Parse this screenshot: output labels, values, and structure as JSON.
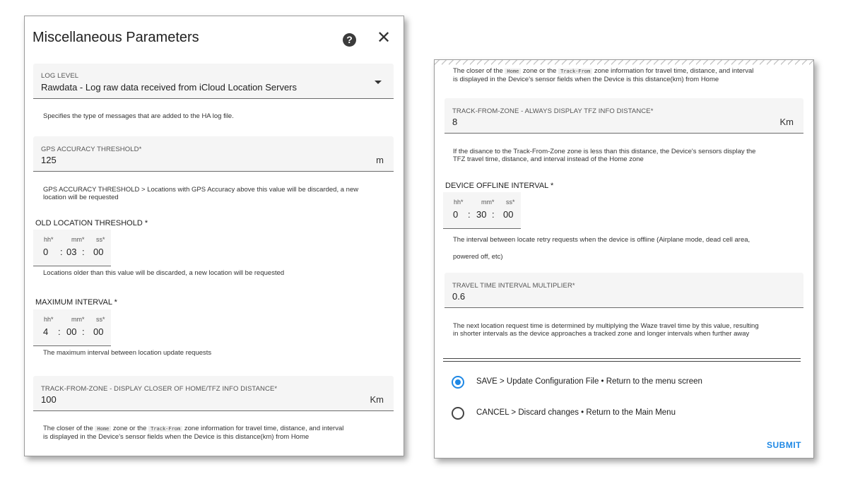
{
  "dialog": {
    "title": "Miscellaneous Parameters",
    "help_icon": "question-circle-icon",
    "close_icon": "close-x-icon"
  },
  "left": {
    "log_level": {
      "label": "Log Level",
      "value": "Rawdata - Log raw data received from iCloud Location Servers",
      "help": "Specifies the type of messages that are added to the HA log file."
    },
    "gps_accuracy": {
      "label": "GPS Accuracy Threshold*",
      "value": "125",
      "suffix": "m",
      "help": "GPS ACCURACY THRESHOLD > Locations with GPS Accuracy above this value will be discarded, a new location will be requested"
    },
    "old_location": {
      "title": "OLD LOCATION THRESHOLD *",
      "hh_label": "hh*",
      "mm_label": "mm*",
      "ss_label": "ss*",
      "hh": "0",
      "mm": "03",
      "ss": "00",
      "help": "Locations older than this value will be discarded, a new location will be requested"
    },
    "max_interval": {
      "title": "MAXIMUM INTERVAL *",
      "hh_label": "hh*",
      "mm_label": "mm*",
      "ss_label": "ss*",
      "hh": "4",
      "mm": "00",
      "ss": "00",
      "help": "The maximum interval between location update requests"
    },
    "tfz_closer": {
      "label": "Track-From-Zone - Display Closer of Home/TFZ Info Distance*",
      "value": "100",
      "suffix": "Km",
      "help_pre": "The closer of the",
      "help_code1": "Home",
      "help_mid": "zone or the",
      "help_code2": "Track-From",
      "help_post": "zone information for travel time, distance, and interval",
      "help_line2": "is displayed in the Device's sensor fields when the Device is this distance(km) from Home"
    }
  },
  "right": {
    "top_help_pre": "The closer of the",
    "top_help_code1": "Home",
    "top_help_mid": "zone or the",
    "top_help_code2": "Track-From",
    "top_help_post": "zone information for travel time, distance, and interval",
    "top_help_line2": "is displayed in the Device's sensor fields when the Device is this distance(km) from Home",
    "tfz_always": {
      "label": "Track-From-Zone - Always Display TFZ Info Distance*",
      "value": "8",
      "suffix": "Km",
      "help_line1": "If the disance to the Track-From-Zone zone is less than this distance, the Device's sensors display the",
      "help_line2": "TFZ travel time, distance, and interval instead of the Home zone"
    },
    "offline_interval": {
      "title": "DEVICE OFFLINE INTERVAL *",
      "hh_label": "hh*",
      "mm_label": "mm*",
      "ss_label": "ss*",
      "hh": "0",
      "mm": "30",
      "ss": "00",
      "help_line1": "The interval between locate retry requests when the device is offline (Airplane mode, dead cell area,",
      "help_line2": "powered off, etc)"
    },
    "travel_multiplier": {
      "label": "Travel Time Interval Multiplier*",
      "value": "0.6",
      "help_line1": "The next location request time is determined by multiplying the Waze travel time by this value, resulting",
      "help_line2": "in shorter intervals as the device approaches a tracked zone and longer intervals when further away"
    },
    "actions": {
      "save": "SAVE > Update Configuration File • Return to the menu screen",
      "cancel": "CANCEL > Discard changes • Return to the Main Menu",
      "selected": "save",
      "submit": "SUBMIT"
    }
  },
  "colors": {
    "accent": "#1e88e5",
    "field_bg": "#f5f5f5"
  }
}
